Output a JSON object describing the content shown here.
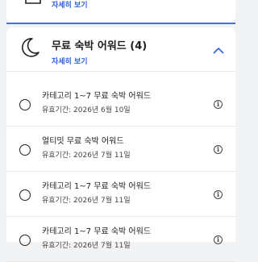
{
  "top_card": {
    "detail_label": "자세히 보기",
    "icon": "ticket-icon"
  },
  "section": {
    "title": "무료 숙박 어워드 (4)",
    "detail_label": "자세히 보기",
    "icon": "moon-icon",
    "expanded": true
  },
  "items": [
    {
      "title": "카테고리 1~7 무료 숙박 어워드",
      "expiry": "유효기간: 2026년 6월 10일"
    },
    {
      "title": "얼티밋 무료 숙박 어워드",
      "expiry": "유효기간: 2026년 7월 11일"
    },
    {
      "title": "카테고리 1~7 무료 숙박 어워드",
      "expiry": "유효기간: 2026년 7월 11일"
    },
    {
      "title": "카테고리 1~7 무료 숙박 어워드",
      "expiry": "유효기간: 2026년 7월 11일"
    }
  ],
  "colors": {
    "accent": "#2f63d9",
    "divider": "#4a6cf7"
  }
}
